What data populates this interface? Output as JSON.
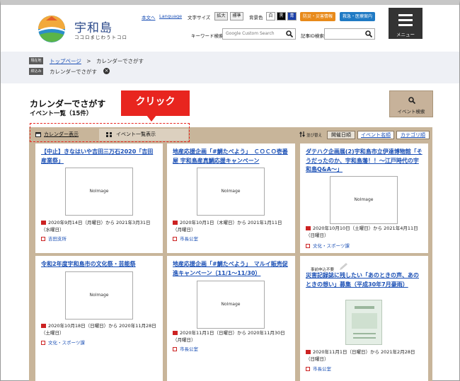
{
  "header": {
    "logo_title": "宇和島",
    "logo_subtitle": "ココロまじわうトコロ",
    "link_text_version": "本文へ",
    "link_language": "Language",
    "text_size_label": "文字サイズ",
    "text_size_large": "拡大",
    "text_size_standard": "標準",
    "bg_color_label": "背景色",
    "bg_white": "白",
    "bg_black": "黒",
    "bg_blue": "青",
    "disaster_label": "防災・災害情報",
    "medical_label": "救急・医療案内",
    "keyword_label": "キーワード検索",
    "keyword_placeholder": "Google Custom Search",
    "article_id_label": "記事ID検索",
    "menu_label": "メニュー"
  },
  "breadcrumb": {
    "current_tag": "現在地",
    "home_link": "トップページ",
    "separator": ">",
    "current_page": "カレンダーでさがす",
    "filter_tag": "絞込み",
    "filter_value": "カレンダーでさがす"
  },
  "page": {
    "title": "カレンダーでさがす",
    "subtitle": "イベント一覧（15件）",
    "callout": "クリック",
    "event_search_label": "イベント検索"
  },
  "tabs": {
    "calendar_view": "カレンダー表示",
    "list_view": "イベント一覧表示"
  },
  "sort": {
    "label": "並び替え",
    "by_date": "開催日順",
    "by_name": "イベント名順",
    "by_category": "カテゴリ順"
  },
  "events": [
    {
      "title": "【中止】きなはいや吉田三万石2020「吉田産業祭」",
      "image": "NoImage",
      "date": "2020年9月14日（月曜日）から 2021年3月31日（水曜日）",
      "dept": "吉田支所"
    },
    {
      "title": "地産応援企画「#鯛たべよう」　ＣＯＣＯ壱番屋 宇和島産真鯛応援キャンペーン",
      "image": "NoImage",
      "date": "2020年10月1日（木曜日）から 2021年1月11日（月曜日）",
      "dept": "市長公室"
    },
    {
      "title": "ダテハク企画展(2)宇和島市立伊達博物館「そうだったのか、宇和島藩！！～江戸時代の宇和島Q&A～」",
      "image": "NoImage",
      "date": "2020年10月10日（土曜日）から 2021年4月11日（日曜日）",
      "dept": "文化・スポーツ課"
    },
    {
      "title": "令和2年度宇和島市の文化祭・芸能祭",
      "image": "NoImage",
      "date": "2020年10月18日（日曜日）から 2020年11月28日（土曜日）",
      "dept": "文化・スポーツ課"
    },
    {
      "title": "地産応援企画「#鯛たべよう」　マルイ販売促進キャンペーン（11/1～11/30）",
      "image": "NoImage",
      "date": "2020年11月1日（日曜日）から 2020年11月30日（月曜日）",
      "dept": "市長公室"
    },
    {
      "title": "災害記録誌に残したい「あのときの声、あのときの想い」募集（平成30年7月豪雨）",
      "image": "",
      "no_apply": "事前申込不要",
      "date": "2020年11月1日（日曜日）から 2021年2月28日（日曜日）",
      "dept": "市長公室"
    }
  ],
  "colors": {
    "accent_red": "#e8251f",
    "panel_tan": "#c8b59a",
    "link_blue": "#1a4fb5",
    "menu_dark": "#333333"
  }
}
